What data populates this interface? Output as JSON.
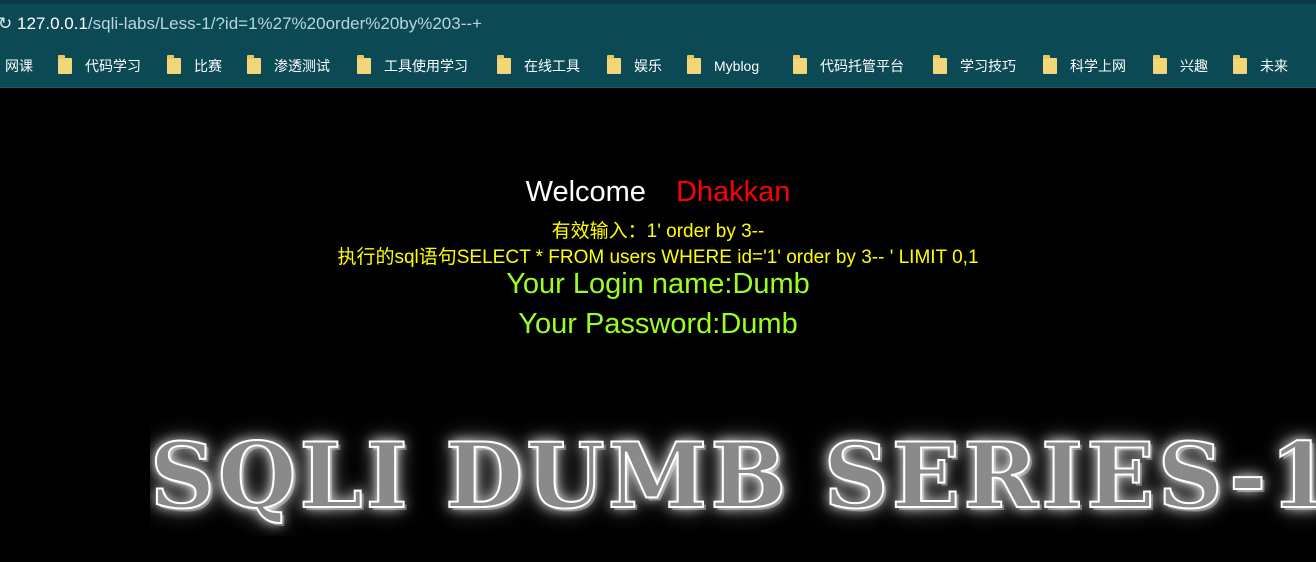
{
  "addressbar": {
    "reload_glyph": "↻",
    "url_host": "127.0.0.1",
    "url_path": "/sqli-labs/Less-1/?id=1%27%20order%20by%203--+"
  },
  "bookmarks": [
    {
      "label": "网课",
      "folder": false
    },
    {
      "label": "代码学习",
      "folder": true
    },
    {
      "label": "比赛",
      "folder": true
    },
    {
      "label": "渗透测试",
      "folder": true
    },
    {
      "label": "工具使用学习",
      "folder": true
    },
    {
      "label": "在线工具",
      "folder": true
    },
    {
      "label": "娱乐",
      "folder": true
    },
    {
      "label": "Myblog",
      "folder": true
    },
    {
      "label": "代码托管平台",
      "folder": true
    },
    {
      "label": "学习技巧",
      "folder": true
    },
    {
      "label": "科学上网",
      "folder": true
    },
    {
      "label": "兴趣",
      "folder": true
    },
    {
      "label": "未来",
      "folder": true
    }
  ],
  "page": {
    "welcome_text": "Welcome",
    "welcome_name": "Dhakkan",
    "valid_input": "有效输入：1' order by 3--",
    "executed_sql": "执行的sql语句SELECT * FROM users WHERE id='1' order by 3-- ' LIMIT 0,1",
    "login_name": "Your Login name:Dumb",
    "password": "Your Password:Dumb",
    "banner": "SQLI DUMB SERIES-1"
  }
}
